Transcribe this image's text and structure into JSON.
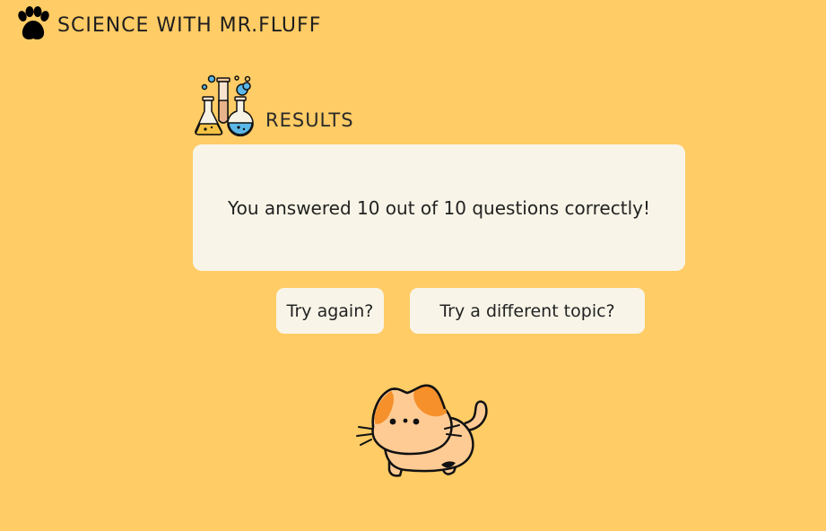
{
  "header": {
    "logo_icon": "paw-icon",
    "title": "SCIENCE WITH MR.FLUFF"
  },
  "results": {
    "icon": "lab-flasks-icon",
    "heading": "RESULTS",
    "message": "You answered 10 out of 10 questions correctly!",
    "correct": 10,
    "total": 10
  },
  "actions": {
    "try_again_label": "Try again?",
    "different_topic_label": "Try a different topic?"
  },
  "mascot": {
    "icon": "cat-mascot-icon"
  },
  "colors": {
    "background": "#FFCC66",
    "card": "#F8F5E8",
    "cat_orange": "#F5902A",
    "cat_body": "#FFCB94"
  }
}
